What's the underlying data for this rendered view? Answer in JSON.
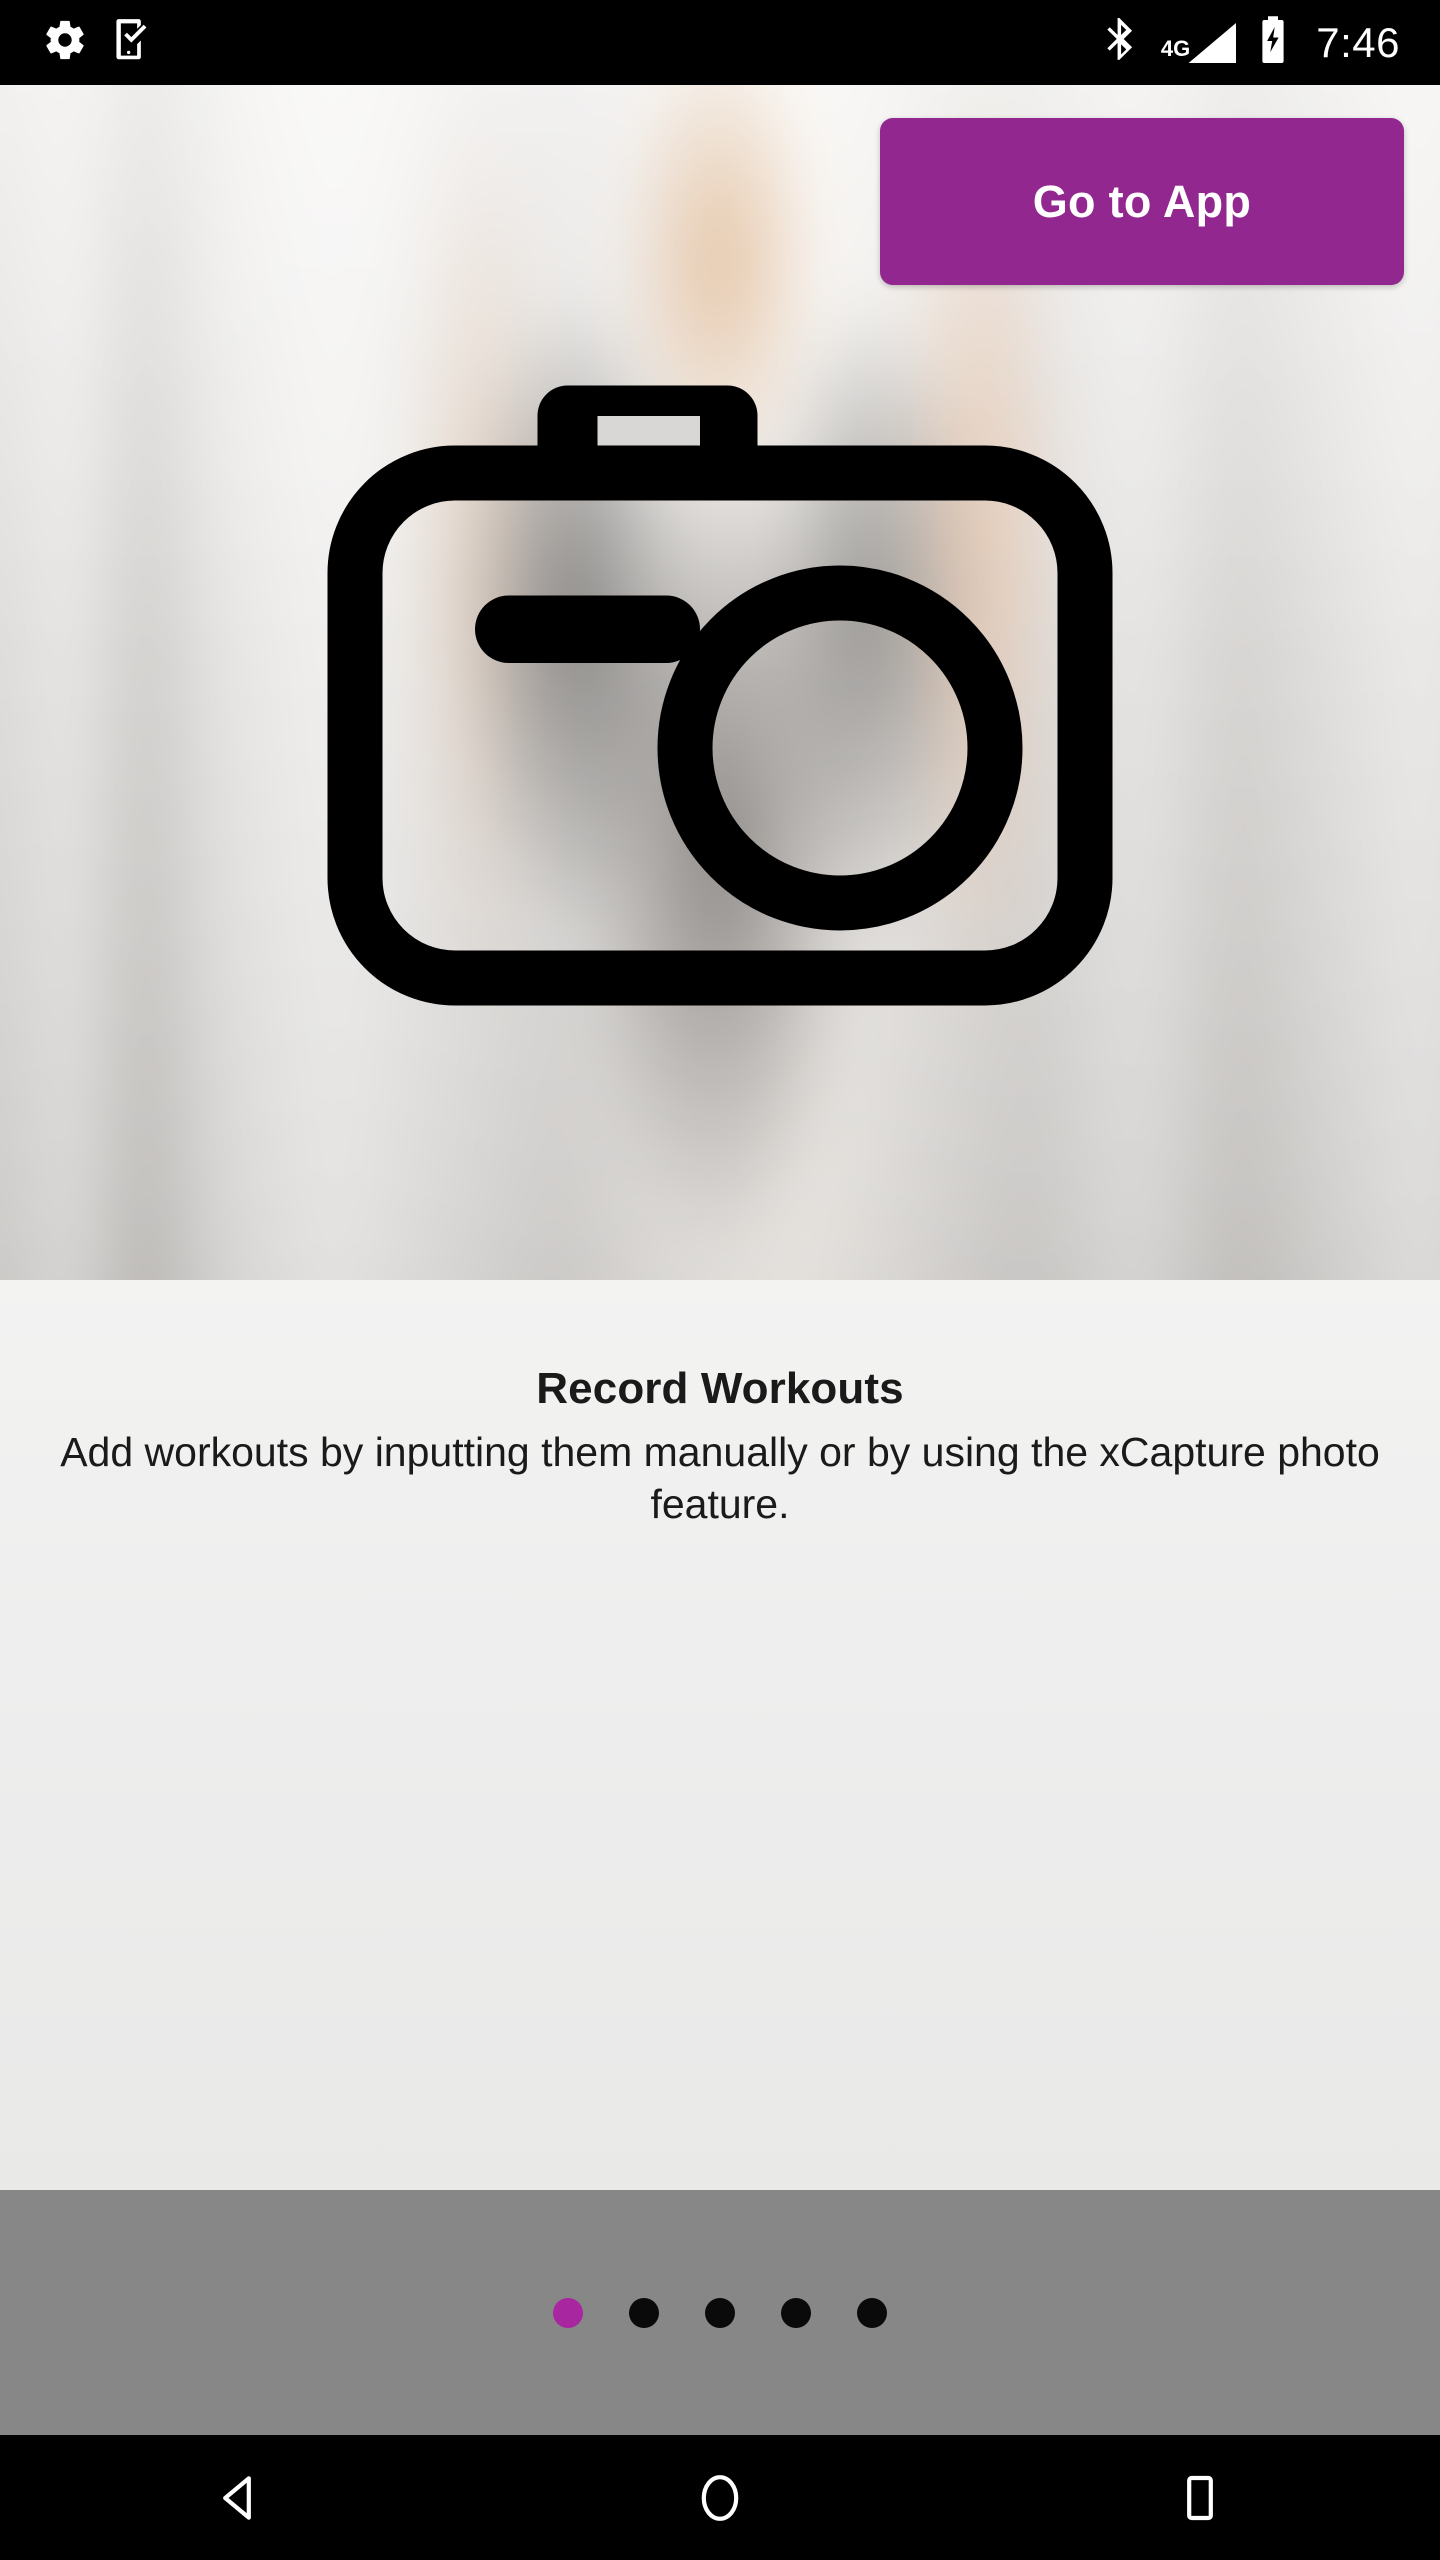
{
  "status_bar": {
    "notification_icons": [
      {
        "name": "settings-gear-icon",
        "label": "Settings"
      },
      {
        "name": "phone-check-icon",
        "label": "Device setup complete"
      }
    ],
    "bluetooth_icon": "bluetooth-icon",
    "network_type": "4G",
    "signal_icon": "cellular-signal-icon",
    "battery_icon": "battery-charging-icon",
    "time": "7:46",
    "background_color": "#000000",
    "foreground_color": "#ffffff"
  },
  "hero": {
    "name": "onboarding-hero-image",
    "alt": "Blurred photo of a person walking on a treadmill in a gym",
    "feature_icon": "camera-icon"
  },
  "go_to_app": {
    "label": "Go to App",
    "background_color": "#92278f",
    "text_color": "#ffffff"
  },
  "feature": {
    "title": "Record Workouts",
    "description": "Add workouts by inputting them manually or by using the xCapture photo feature."
  },
  "page_indicator": {
    "total": 5,
    "current": 1,
    "active_color": "#a8269f",
    "inactive_color": "#0a0a0a",
    "bar_color": "#878787",
    "dots": [
      {
        "index": 1,
        "active": true
      },
      {
        "index": 2,
        "active": false
      },
      {
        "index": 3,
        "active": false
      },
      {
        "index": 4,
        "active": false
      },
      {
        "index": 5,
        "active": false
      }
    ]
  },
  "navigation_bar": {
    "buttons": [
      {
        "name": "nav-back-button",
        "icon": "back-triangle-icon",
        "label": "Back"
      },
      {
        "name": "nav-home-button",
        "icon": "home-circle-icon",
        "label": "Home"
      },
      {
        "name": "nav-recents-button",
        "icon": "recents-square-icon",
        "label": "Recent apps"
      }
    ],
    "background_color": "#000000"
  }
}
